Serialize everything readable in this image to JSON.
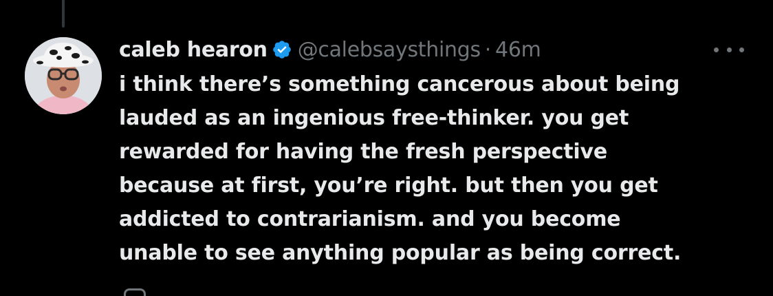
{
  "colors": {
    "background": "#000000",
    "text_primary": "#e7e9ea",
    "text_secondary": "#71767b",
    "verified_blue": "#1d9bf0"
  },
  "tweet": {
    "author": {
      "display_name": "caleb hearon",
      "handle": "@calebsaysthings",
      "verified_icon": "verified-badge-icon",
      "avatar_icon": "avatar"
    },
    "separator": "·",
    "timestamp": "46m",
    "more_icon": "more-options-icon",
    "text_lines": [
      "i think there’s something cancerous about being",
      "lauded as an ingenious free-thinker. you get",
      "rewarded for having the fresh perspective",
      "because at first, you’re right. but then you get",
      "addicted to contrarianism. and you become",
      "unable to see anything popular as being correct."
    ]
  }
}
